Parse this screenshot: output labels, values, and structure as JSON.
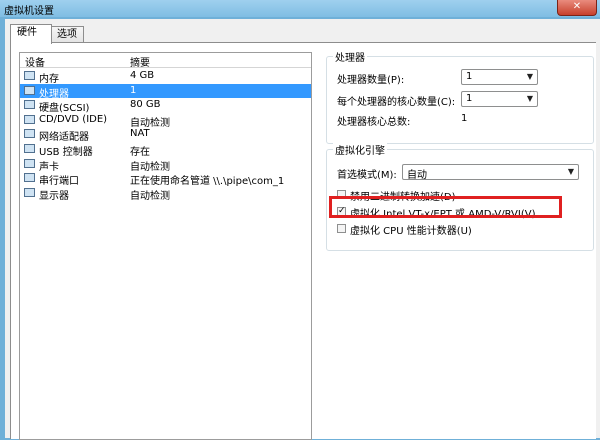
{
  "window": {
    "title": "虚拟机设置",
    "close": "✕"
  },
  "tabs": [
    {
      "label": "硬件"
    },
    {
      "label": "选项"
    }
  ],
  "device_list": {
    "headers": {
      "device": "设备",
      "summary": "摘要"
    },
    "rows": [
      {
        "name": "内存",
        "summary": "4 GB",
        "icon": "memory-icon"
      },
      {
        "name": "处理器",
        "summary": "1",
        "icon": "processor-icon"
      },
      {
        "name": "硬盘(SCSI)",
        "summary": "80 GB",
        "icon": "hard-disk-icon"
      },
      {
        "name": "CD/DVD (IDE)",
        "summary": "自动检测",
        "icon": "cd-dvd-icon"
      },
      {
        "name": "网络适配器",
        "summary": "NAT",
        "icon": "network-adapter-icon"
      },
      {
        "name": "USB 控制器",
        "summary": "存在",
        "icon": "usb-controller-icon"
      },
      {
        "name": "声卡",
        "summary": "自动检测",
        "icon": "sound-card-icon"
      },
      {
        "name": "串行端口",
        "summary": "正在使用命名管道 \\\\.\\pipe\\com_1",
        "icon": "serial-port-icon"
      },
      {
        "name": "显示器",
        "summary": "自动检测",
        "icon": "display-icon"
      }
    ]
  },
  "processor": {
    "group_label": "处理器",
    "count_label": "处理器数量(P):",
    "count_value": "1",
    "cores_label": "每个处理器的核心数量(C):",
    "cores_value": "1",
    "total_label": "处理器核心总数:",
    "total_value": "1"
  },
  "virt": {
    "group_label": "虚拟化引擎",
    "mode_label": "首选模式(M):",
    "mode_value": "自动",
    "opt_binary": "禁用二进制转换加速(D)",
    "opt_vtx": "虚拟化 Intel VT-x/EPT 或 AMD-V/RVI(V)",
    "opt_perf": "虚拟化 CPU 性能计数器(U)",
    "vtx_checked": "✓"
  }
}
